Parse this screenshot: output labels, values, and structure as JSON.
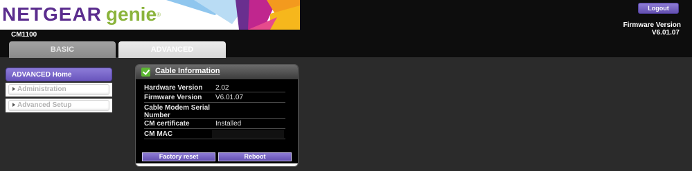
{
  "header": {
    "logo_brand": "NETGEAR",
    "logo_product": "genie",
    "logo_reg": "®",
    "model": "CM1100",
    "logout_label": "Logout",
    "firmware_label": "Firmware Version",
    "firmware_value": "V6.01.07"
  },
  "tabs": [
    {
      "label": "BASIC",
      "active": false
    },
    {
      "label": "ADVANCED",
      "active": true
    }
  ],
  "nav": {
    "active_item": "ADVANCED Home",
    "items": [
      "Administration",
      "Advanced Setup"
    ]
  },
  "cable_info": {
    "title": "Cable Information",
    "rows": [
      {
        "label": "Hardware Version",
        "value": "2.02"
      },
      {
        "label": "Firmware Version",
        "value": "V6.01.07"
      },
      {
        "label": "Cable Modem Serial Number",
        "value": ""
      },
      {
        "label": "CM certificate",
        "value": "Installed"
      },
      {
        "label": "CM MAC",
        "value": ""
      }
    ],
    "buttons": {
      "factory_reset": "Factory reset",
      "reboot": "Reboot"
    }
  },
  "colors": {
    "brand_purple": "#5b2d8e",
    "genie_green": "#8bb43c",
    "button_purple": "#6a56bd",
    "status_green": "#5db832"
  }
}
